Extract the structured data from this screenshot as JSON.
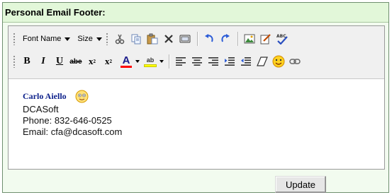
{
  "panel": {
    "title": "Personal Email Footer:"
  },
  "toolbar": {
    "font_name_label": "Font Name",
    "size_label": "Size",
    "row1_icons": [
      "cut-icon",
      "copy-icon",
      "paste-icon",
      "delete-icon",
      "paste-text-icon",
      "undo-icon",
      "redo-icon",
      "insert-image-icon",
      "edit-icon",
      "spellcheck-icon"
    ],
    "row2_buttons": {
      "bold": "B",
      "italic": "I",
      "underline": "U",
      "strikethrough": "abe",
      "superscript": "x",
      "subscript": "x",
      "font_color": "A",
      "highlight": "ab"
    },
    "colors": {
      "font_color_bar": "#ff0000",
      "highlight_bar": "#ffff00"
    }
  },
  "editor_content": {
    "name": "Carlo Aiello",
    "company": "DCASoft",
    "phone": "Phone: 832-646-0525",
    "email": "Email: cfa@dcasoft.com"
  },
  "actions": {
    "update_label": "Update"
  },
  "colors": {
    "panel_bg": "#f2fbef",
    "header_bg": "#e2f7d9",
    "name_color": "#0b1f8a"
  }
}
